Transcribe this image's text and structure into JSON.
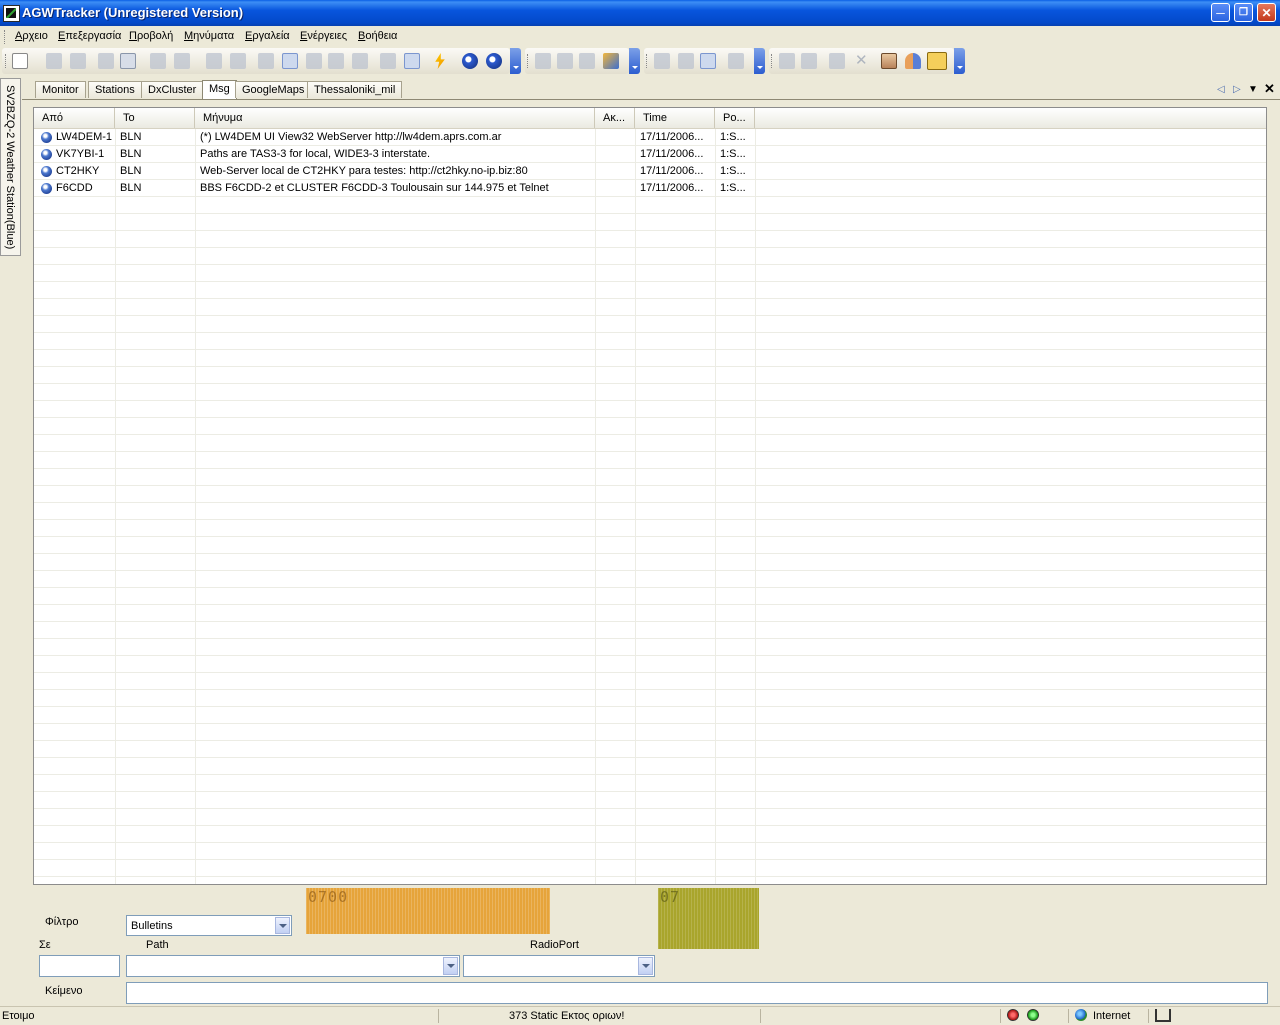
{
  "window": {
    "title": "AGWTracker (Unregistered Version)"
  },
  "menu": [
    "Αρχειο",
    "Επεξεργασία",
    "Προβολή",
    "Μηνύματα",
    "Εργαλεία",
    "Ενέργειες",
    "Βοήθεια"
  ],
  "side_tab": "SV2BZQ-2 Weather Station(Blue)",
  "tabs": [
    {
      "label": "Monitor",
      "active": false
    },
    {
      "label": "Stations",
      "active": false
    },
    {
      "label": "DxCluster",
      "active": false
    },
    {
      "label": "Msg",
      "active": true
    },
    {
      "label": "GoogleMaps",
      "active": false
    },
    {
      "label": "Thessaloniki_mil",
      "active": false
    }
  ],
  "columns": [
    "Από",
    "To",
    "Μήνυμα",
    "Ακ...",
    "Time",
    "Po..."
  ],
  "rows": [
    {
      "from": "LW4DEM-1",
      "to": "BLN",
      "message": "(*) LW4DEM UI View32 WebServer http://lw4dem.aprs.com.ar",
      "ack": "",
      "time": "17/11/2006...",
      "port": "1:S..."
    },
    {
      "from": "VK7YBI-1",
      "to": "BLN",
      "message": "Paths are TAS3-3 for local, WIDE3-3 interstate.",
      "ack": "",
      "time": "17/11/2006...",
      "port": "1:S..."
    },
    {
      "from": "CT2HKY",
      "to": "BLN",
      "message": "Web-Server local de CT2HKY para testes: http://ct2hky.no-ip.biz:80",
      "ack": "",
      "time": "17/11/2006...",
      "port": "1:S..."
    },
    {
      "from": "F6CDD",
      "to": "BLN",
      "message": "BBS F6CDD-2 et CLUSTER F6CDD-3 Toulousain sur 144.975 et Telnet",
      "ack": "",
      "time": "17/11/2006...",
      "port": "1:S..."
    }
  ],
  "form": {
    "filter_label": "Φίλτρο",
    "filter_value": "Bulletins",
    "to_label": "Σε",
    "to_value": "",
    "path_label": "Path",
    "path_value": "",
    "radioport_label": "RadioPort",
    "radioport_value": "",
    "text_label": "Κείμενο",
    "text_value": ""
  },
  "digital_display_1": "0700",
  "digital_display_2": "07",
  "status": {
    "left": "Ετοιμο",
    "center": "373 Static Εκτος οριων!",
    "zone": "Internet"
  },
  "colors": {
    "titlebar": "#0855DD",
    "display_orange": "#E6A43A",
    "display_olive": "#A9A52C"
  }
}
